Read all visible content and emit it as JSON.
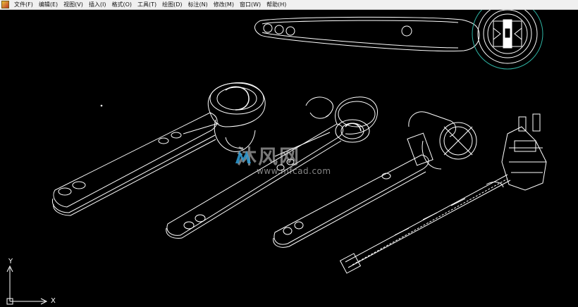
{
  "menu": {
    "items": [
      {
        "label": "文件(F)"
      },
      {
        "label": "编辑(E)"
      },
      {
        "label": "视图(V)"
      },
      {
        "label": "插入(I)"
      },
      {
        "label": "格式(O)"
      },
      {
        "label": "工具(T)"
      },
      {
        "label": "绘图(D)"
      },
      {
        "label": "标注(N)"
      },
      {
        "label": "修改(M)"
      },
      {
        "label": "窗口(W)"
      },
      {
        "label": "帮助(H)"
      }
    ]
  },
  "canvas": {
    "background": "#000000",
    "line_color": "#ffffff",
    "circle_color": "#2fb5a5",
    "ucs": {
      "x_label": "X",
      "y_label": "Y"
    }
  },
  "watermark": {
    "brand": "沐风网",
    "url": "www.mfcad.com",
    "color": "#2f9fd8"
  }
}
